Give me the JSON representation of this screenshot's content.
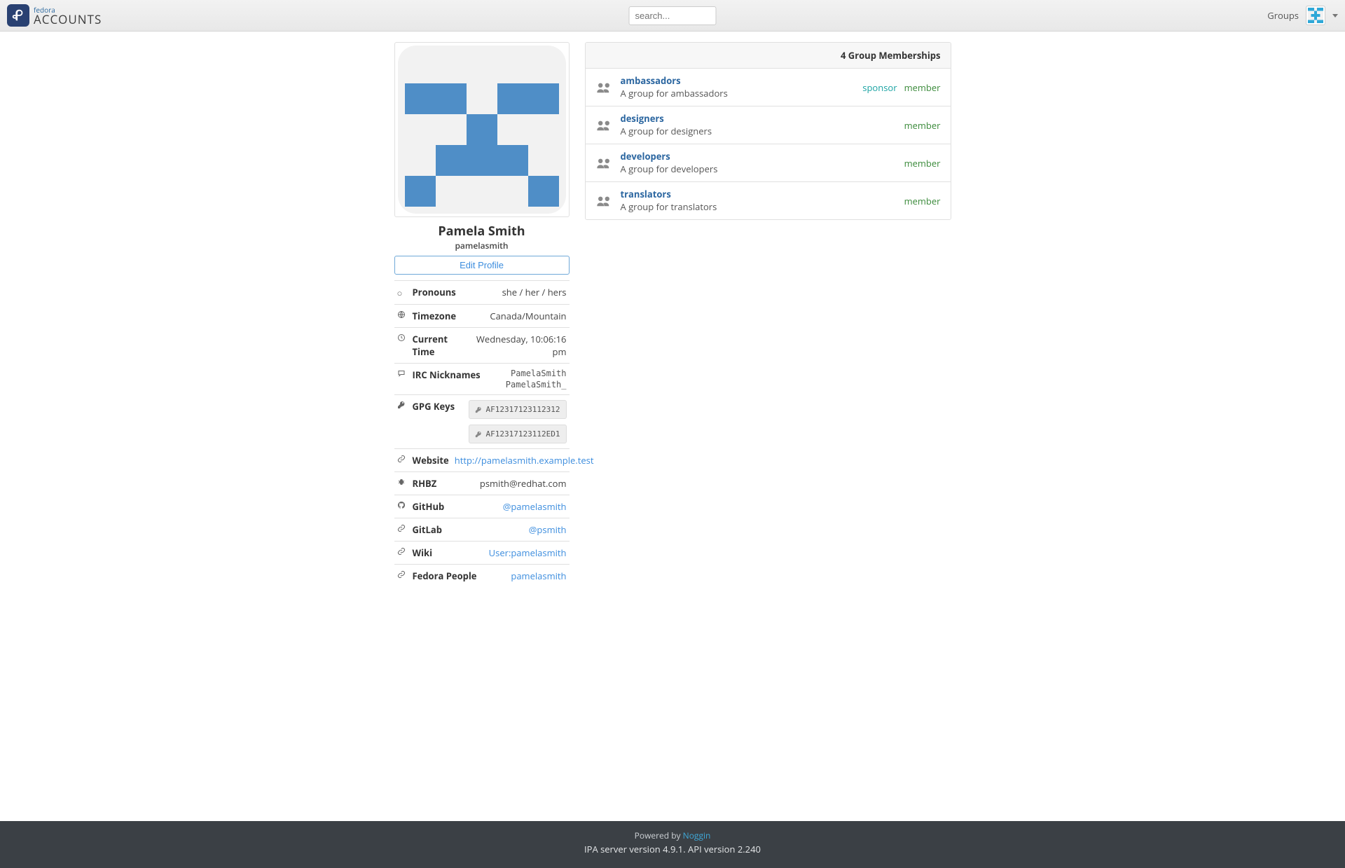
{
  "header": {
    "brand_small": "fedora",
    "brand_large": "ACCOUNTS",
    "search_placeholder": "search...",
    "groups_link": "Groups"
  },
  "profile": {
    "name": "Pamela Smith",
    "username": "pamelasmith",
    "edit_label": "Edit Profile",
    "rows": {
      "pronouns_label": "Pronouns",
      "pronouns_value": "she / her / hers",
      "timezone_label": "Timezone",
      "timezone_value": "Canada/Mountain",
      "current_time_label": "Current Time",
      "current_time_value": "Wednesday, 10:06:16 pm",
      "irc_label": "IRC Nicknames",
      "irc_values": [
        "PamelaSmith",
        "PamelaSmith_"
      ],
      "gpg_label": "GPG Keys",
      "gpg_values": [
        "AF12317123112312",
        "AF12317123112ED1"
      ],
      "website_label": "Website",
      "website_value": "http://pamelasmith.example.test",
      "rhbz_label": "RHBZ",
      "rhbz_value": "psmith@redhat.com",
      "github_label": "GitHub",
      "github_value": "@pamelasmith",
      "gitlab_label": "GitLab",
      "gitlab_value": "@psmith",
      "wiki_label": "Wiki",
      "wiki_value": "User:pamelasmith",
      "fedorapeople_label": "Fedora People",
      "fedorapeople_value": "pamelasmith"
    }
  },
  "memberships": {
    "title": "4 Group Memberships",
    "groups": [
      {
        "name": "ambassadors",
        "desc": "A group for ambassadors",
        "roles": [
          "sponsor",
          "member"
        ]
      },
      {
        "name": "designers",
        "desc": "A group for designers",
        "roles": [
          "member"
        ]
      },
      {
        "name": "developers",
        "desc": "A group for developers",
        "roles": [
          "member"
        ]
      },
      {
        "name": "translators",
        "desc": "A group for translators",
        "roles": [
          "member"
        ]
      }
    ]
  },
  "footer": {
    "powered_by_text": "Powered by ",
    "powered_by_link": "Noggin",
    "version_line": "IPA server version 4.9.1. API version 2.240"
  }
}
